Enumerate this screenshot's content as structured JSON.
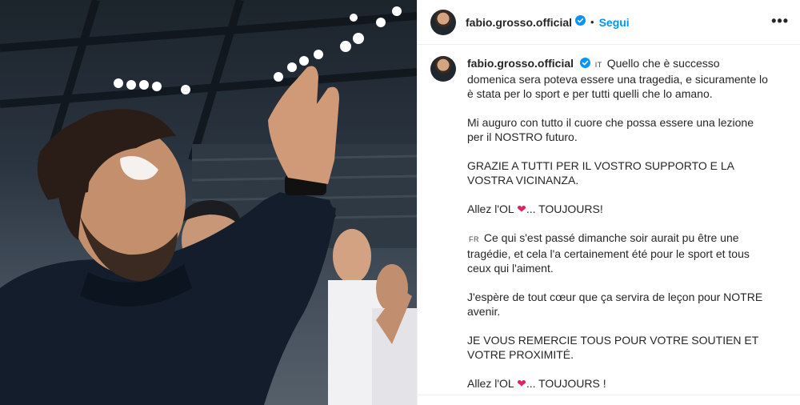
{
  "post": {
    "username": "fabio.grosso.official",
    "follow_label": "Segui",
    "dot": "•",
    "more": "•••"
  },
  "caption": {
    "lang_it": "IT",
    "it_p1": "Quello che è successo domenica sera poteva essere una tragedia, e sicuramente lo è stata per lo sport e per tutti quelli che lo amano.",
    "it_p2": "Mi auguro con tutto il cuore che possa essere una lezione per il NOSTRO futuro.",
    "it_p3": "GRAZIE A TUTTI PER IL VOSTRO SUPPORTO E LA VOSTRA VICINANZA.",
    "it_p4_a": "Allez l'OL",
    "it_p4_b": "... TOUJOURS!",
    "lang_fr": "FR",
    "fr_p1": "Ce qui s'est passé dimanche soir aurait pu être une tragédie, et cela l'a certainement été pour le sport et tous ceux qui l'aiment.",
    "fr_p2": "J'espère de tout cœur que ça servira de leçon pour NOTRE avenir.",
    "fr_p3": "JE VOUS REMERCIE TOUS POUR VOTRE SOUTIEN ET VOTRE PROXIMITÉ.",
    "fr_p4_a": "Allez l'OL",
    "fr_p4_b": "... TOUJOURS !",
    "heart": "❤"
  },
  "colors": {
    "link": "#0095f6",
    "verified": "#0095f6",
    "heart": "#e0245e"
  }
}
